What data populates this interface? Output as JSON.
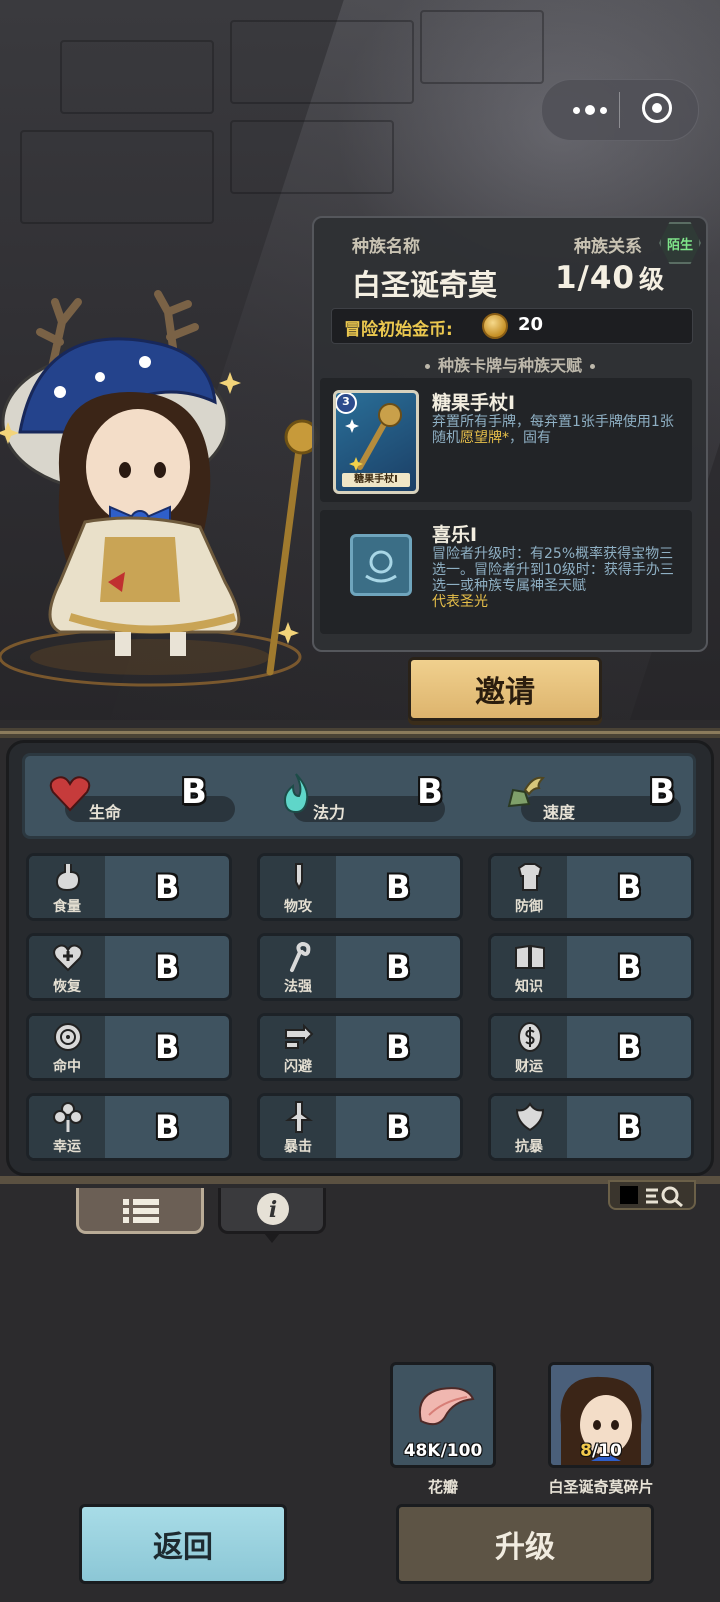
{
  "header": {
    "race_name_label": "种族名称",
    "race_relation_label": "种族关系",
    "relation_badge": "陌生",
    "race_name": "白圣诞奇莫",
    "level_value": "1/40",
    "level_unit": "级",
    "gold_label": "冒险初始金币:",
    "gold_value": "20",
    "section_title": "种族卡牌与种族天赋"
  },
  "card": {
    "name": "糖果手杖I",
    "cost": "3",
    "card_label": "糖果手杖I",
    "desc_prefix": "弃置所有手牌，每弃置1张手牌使用1张随机",
    "desc_highlight": "愿望牌*",
    "desc_suffix": "，固有"
  },
  "talent": {
    "name": "喜乐I",
    "desc": "冒险者升级时：有25%概率获得宝物三选一。冒险者升到10级时：获得手办三选一或种族专属神圣天赋",
    "desc_highlight": "代表圣光"
  },
  "invite_label": "邀请",
  "main_stats": [
    {
      "label": "生命",
      "grade": "B",
      "icon": "heart-icon"
    },
    {
      "label": "法力",
      "grade": "B",
      "icon": "flame-icon"
    },
    {
      "label": "速度",
      "grade": "B",
      "icon": "wing-boot-icon"
    }
  ],
  "stats": [
    {
      "label": "食量",
      "grade": "B",
      "icon": "stomach-icon"
    },
    {
      "label": "物攻",
      "grade": "B",
      "icon": "sword-icon"
    },
    {
      "label": "防御",
      "grade": "B",
      "icon": "armor-icon"
    },
    {
      "label": "恢复",
      "grade": "B",
      "icon": "heart-plus-icon"
    },
    {
      "label": "法强",
      "grade": "B",
      "icon": "staff-icon"
    },
    {
      "label": "知识",
      "grade": "B",
      "icon": "book-icon"
    },
    {
      "label": "命中",
      "grade": "B",
      "icon": "target-icon"
    },
    {
      "label": "闪避",
      "grade": "B",
      "icon": "dodge-icon"
    },
    {
      "label": "财运",
      "grade": "B",
      "icon": "coin-dollar-icon"
    },
    {
      "label": "幸运",
      "grade": "B",
      "icon": "clover-icon"
    },
    {
      "label": "暴击",
      "grade": "B",
      "icon": "critical-icon"
    },
    {
      "label": "抗暴",
      "grade": "B",
      "icon": "shield-flower-icon"
    }
  ],
  "materials": [
    {
      "name": "花瓣",
      "qty_cur": "48K",
      "qty_sep": "/",
      "qty_max": "100"
    },
    {
      "name": "白圣诞奇莫碎片",
      "qty_cur": "8",
      "qty_sep": "/",
      "qty_max": "10"
    }
  ],
  "buttons": {
    "back": "返回",
    "upgrade": "升级"
  },
  "colors": {
    "accent_gold": "#ebc84f",
    "panel": "#3f5360",
    "back_button": "#a8dce7",
    "upgrade_button": "#5d5445"
  }
}
